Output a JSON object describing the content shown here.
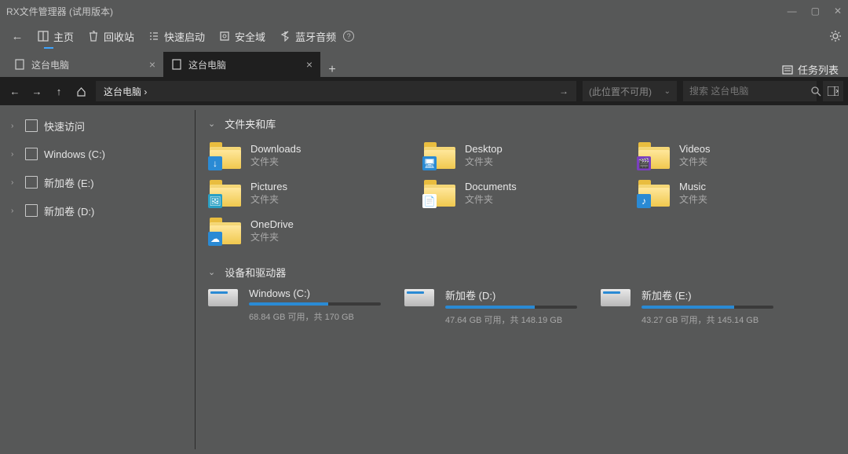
{
  "window": {
    "title": "RX文件管理器 (试用版本)"
  },
  "toolbar": {
    "home": "主页",
    "recycle": "回收站",
    "quickstart": "快速启动",
    "security": "安全域",
    "bluetooth": "蓝牙音频"
  },
  "tabs": [
    {
      "label": "这台电脑",
      "active": false
    },
    {
      "label": "这台电脑",
      "active": true
    }
  ],
  "task_list": "任务列表",
  "address": {
    "path": "这台电脑 ›"
  },
  "location_combo": "(此位置不可用)",
  "search": {
    "placeholder": "搜索 这台电脑"
  },
  "sidebar": [
    {
      "label": "快速访问"
    },
    {
      "label": "Windows (C:)"
    },
    {
      "label": "新加卷 (E:)"
    },
    {
      "label": "新加卷 (D:)"
    }
  ],
  "sections": {
    "folders_title": "文件夹和库",
    "drives_title": "设备和驱动器"
  },
  "folder_type": "文件夹",
  "folders": [
    {
      "name": "Downloads",
      "badge": "↓",
      "badge_bg": "#2a8ad4"
    },
    {
      "name": "Desktop",
      "badge": "🖥",
      "badge_bg": "#2a8ad4"
    },
    {
      "name": "Videos",
      "badge": "🎬",
      "badge_bg": "#7a3fbf"
    },
    {
      "name": "Pictures",
      "badge": "🖼",
      "badge_bg": "#2aa0c4"
    },
    {
      "name": "Documents",
      "badge": "📄",
      "badge_bg": "#ffffff"
    },
    {
      "name": "Music",
      "badge": "♪",
      "badge_bg": "#2a8ad4"
    },
    {
      "name": "OneDrive",
      "badge": "☁",
      "badge_bg": "#2a8ad4"
    }
  ],
  "drives": [
    {
      "name": "Windows (C:)",
      "free": "68.84 GB",
      "total": "170 GB",
      "pct": 60
    },
    {
      "name": "新加卷 (D:)",
      "free": "47.64 GB",
      "total": "148.19 GB",
      "pct": 68
    },
    {
      "name": "新加卷 (E:)",
      "free": "43.27 GB",
      "total": "145.14 GB",
      "pct": 70
    }
  ],
  "drive_text": {
    "available": " 可用，共 "
  }
}
